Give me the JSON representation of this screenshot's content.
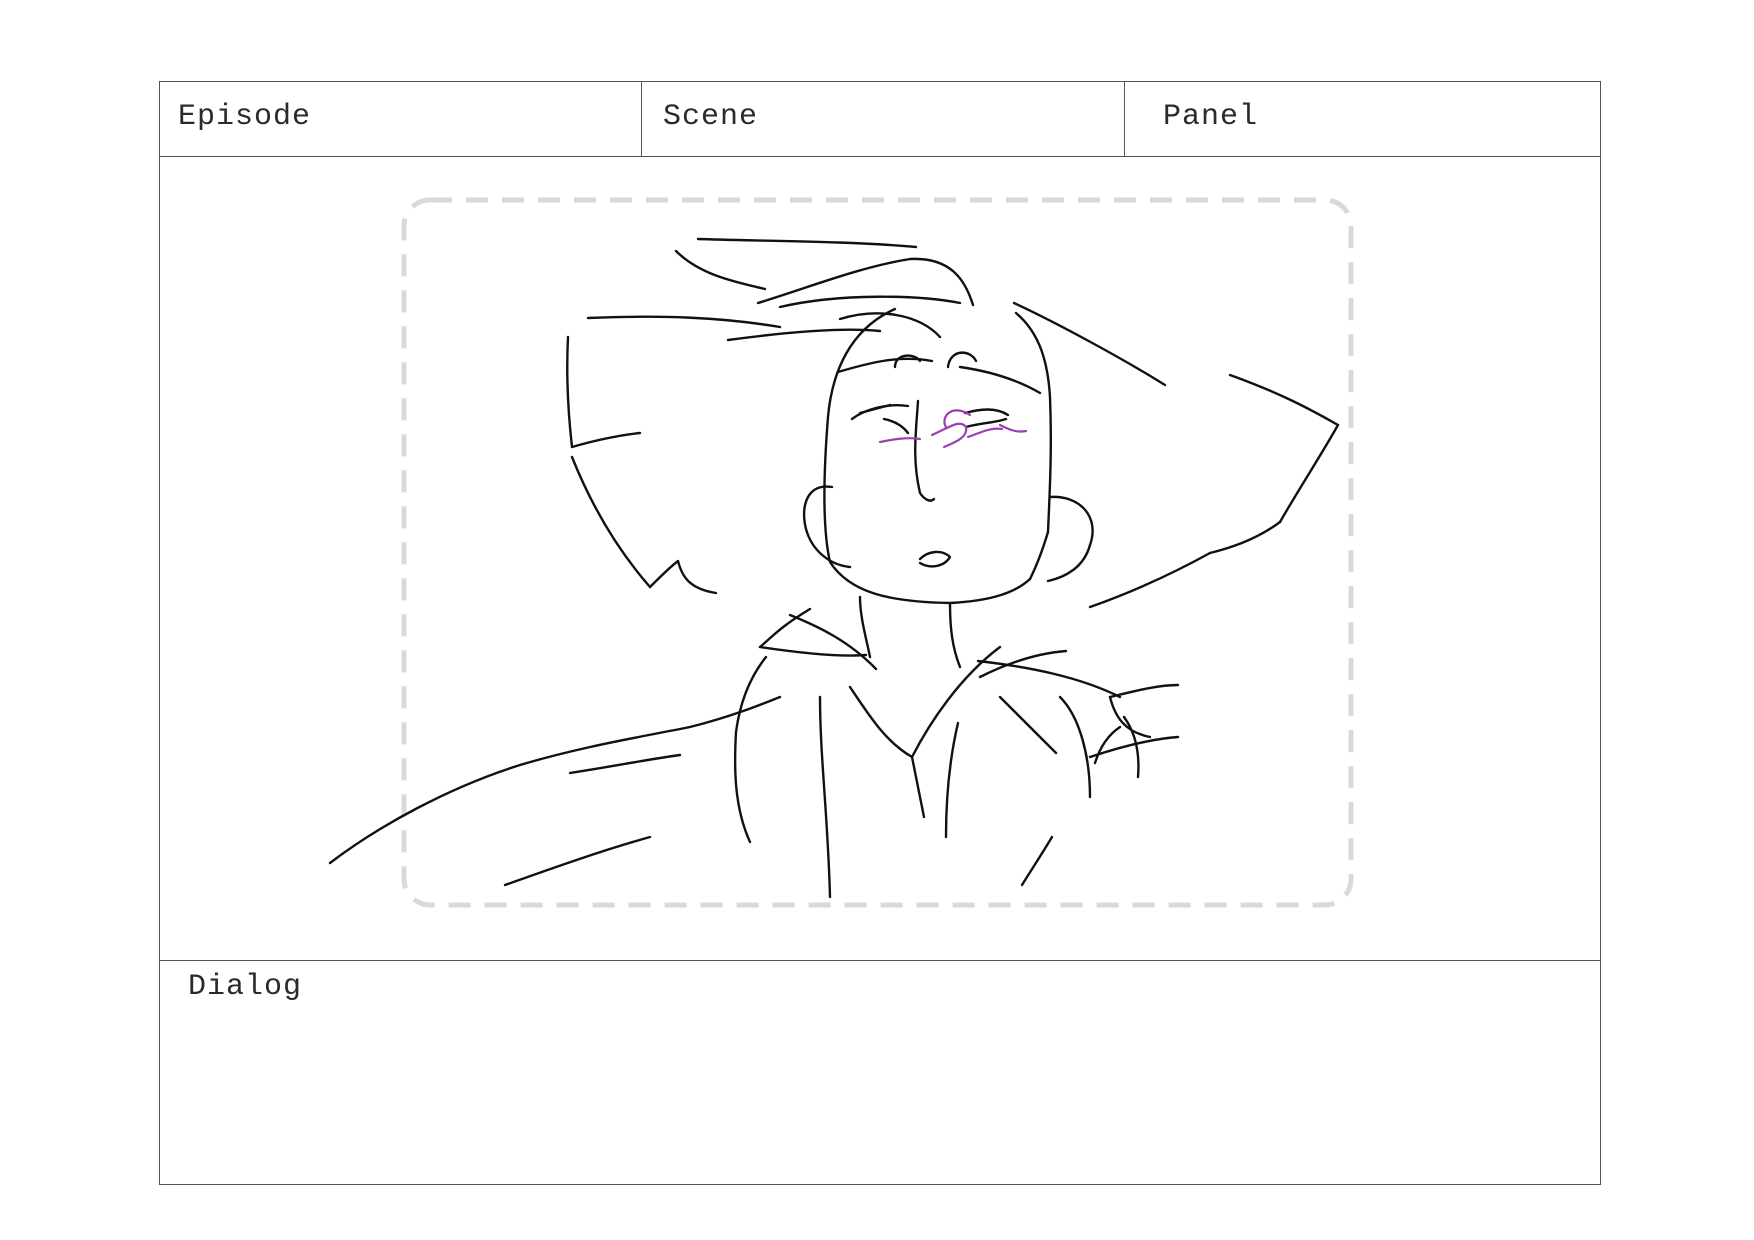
{
  "header": {
    "episode_label": "Episode",
    "scene_label": "Scene",
    "panel_label": "Panel"
  },
  "dialog": {
    "label": "Dialog"
  },
  "colors": {
    "border": "#555555",
    "sketch_line": "#111111",
    "safe_frame": "#d9d9d9",
    "blush": "#9b3fb0"
  }
}
